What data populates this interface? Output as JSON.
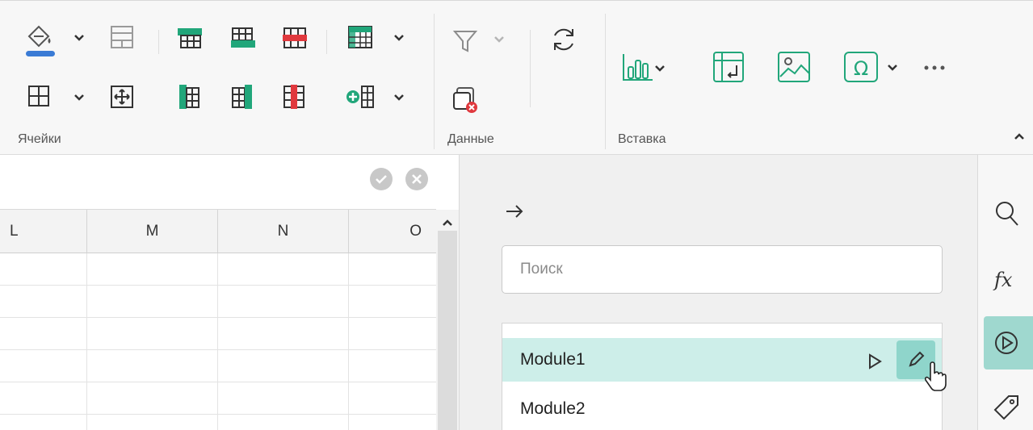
{
  "ribbon": {
    "groups": {
      "cells": "Ячейки",
      "data": "Данные",
      "insert": "Вставка"
    },
    "icons": [
      "fill-color-icon",
      "cell-style-icon",
      "borders-icon",
      "merge-cells-icon",
      "insert-row-above-icon",
      "insert-row-below-icon",
      "delete-row-icon",
      "insert-column-left-icon",
      "insert-column-right-icon",
      "delete-column-icon",
      "table-format-icon",
      "add-column-icon",
      "filter-icon",
      "clear-filter-icon",
      "refresh-icon",
      "chart-icon",
      "pivot-table-icon",
      "image-icon",
      "symbol-icon",
      "more-icon"
    ]
  },
  "sheet": {
    "columns": [
      "L",
      "M",
      "N",
      "O"
    ]
  },
  "panel": {
    "search_placeholder": "Поиск",
    "macros": [
      {
        "name": "Module1",
        "selected": true
      },
      {
        "name": "Module2",
        "selected": false
      }
    ]
  },
  "sidebar": {
    "items": [
      "search-icon",
      "function-icon",
      "macros-icon",
      "tag-icon"
    ],
    "active": "macros-icon"
  },
  "colors": {
    "accent": "#21a67a",
    "selection": "#cdeee9",
    "active_button": "#8fd5cb",
    "delete_red": "#e0393e"
  }
}
